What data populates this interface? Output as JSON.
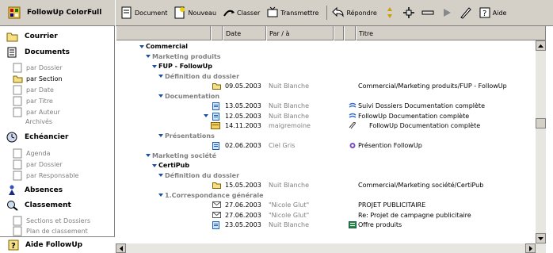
{
  "app": {
    "title": "FollowUp ColorFull"
  },
  "sidebar": {
    "sections": [
      {
        "label": "Courrier",
        "icon": "folder-icon"
      },
      {
        "label": "Documents",
        "icon": "documents-icon"
      },
      {
        "label": "Echéancier",
        "icon": "calendar-icon"
      },
      {
        "label": "Absences",
        "icon": "person-icon"
      },
      {
        "label": "Classement",
        "icon": "magnifier-icon"
      }
    ],
    "documents_items": [
      "par Dossier",
      "par Section",
      "par Date",
      "par Titre",
      "par Auteur",
      "Archivés"
    ],
    "echeancier_items": [
      "Agenda",
      "par Dossier",
      "par Responsable"
    ],
    "classement_items": [
      "Sections et Dossiers",
      "Plan de classement"
    ],
    "footer": "Aide FollowUp"
  },
  "toolbar": {
    "document": "Document",
    "nouveau": "Nouveau",
    "classer": "Classer",
    "transmettre": "Transmettre",
    "repondre": "Répondre",
    "aide": "Aide"
  },
  "table": {
    "headers": {
      "date": "Date",
      "par": "Par / à",
      "titre": "Titre"
    },
    "rows": [
      {
        "type": "group",
        "level": 1,
        "label": "Commercial"
      },
      {
        "type": "group",
        "level": 2,
        "label": "Marketing produits"
      },
      {
        "type": "group",
        "level": 3,
        "label": "FUP - FollowUp"
      },
      {
        "type": "group",
        "level": 4,
        "label": "Définition du dossier"
      },
      {
        "type": "item",
        "icon": "folder",
        "date": "09.05.2003",
        "par": "Nuit Blanche",
        "ticon": "",
        "titre": "Commercial/Marketing produits/FUP - FollowUp"
      },
      {
        "type": "group",
        "level": 4,
        "label": "Documentation"
      },
      {
        "type": "item",
        "icon": "doc",
        "date": "13.05.2003",
        "par": "Nuit Blanche",
        "ticon": "link",
        "titre": "Suivi Dossiers Documentation complète"
      },
      {
        "type": "item",
        "icon": "doc",
        "expand": true,
        "date": "12.05.2003",
        "par": "Nuit Blanche",
        "ticon": "link",
        "titre": "FollowUp Documentation complète"
      },
      {
        "type": "item",
        "icon": "mail",
        "date": "14.11.2003",
        "par": "maigremoine",
        "ticon": "clip",
        "titre": "FollowUp Documentation complète"
      },
      {
        "type": "group",
        "level": 4,
        "label": "Présentations"
      },
      {
        "type": "item",
        "icon": "doc",
        "date": "02.06.2003",
        "par": "Ciel Gris",
        "ticon": "sparkle",
        "titre": "Présention FollowUp"
      },
      {
        "type": "group",
        "level": 2,
        "label": "Marketing société"
      },
      {
        "type": "group",
        "level": 3,
        "label": "CertiPub"
      },
      {
        "type": "group",
        "level": 4,
        "label": "Définition du dossier"
      },
      {
        "type": "item",
        "icon": "folder",
        "date": "15.05.2003",
        "par": "Nuit Blanche",
        "ticon": "",
        "titre": "Commercial/Marketing société/CertiPub"
      },
      {
        "type": "group",
        "level": 4,
        "label": "1.Correspondance générale"
      },
      {
        "type": "item",
        "icon": "env",
        "date": "27.06.2003",
        "par": "\"Nicole Glut\"",
        "ticon": "",
        "titre": "PROJET PUBLICITAIRE"
      },
      {
        "type": "item",
        "icon": "env",
        "date": "27.06.2003",
        "par": "\"Nicole Glut\"",
        "ticon": "",
        "titre": "Re: Projet de campagne publicitaire"
      },
      {
        "type": "item",
        "icon": "doc",
        "date": "23.05.2003",
        "par": "Nuit Blanche",
        "ticon": "table",
        "titre": "Offre produits"
      }
    ]
  }
}
